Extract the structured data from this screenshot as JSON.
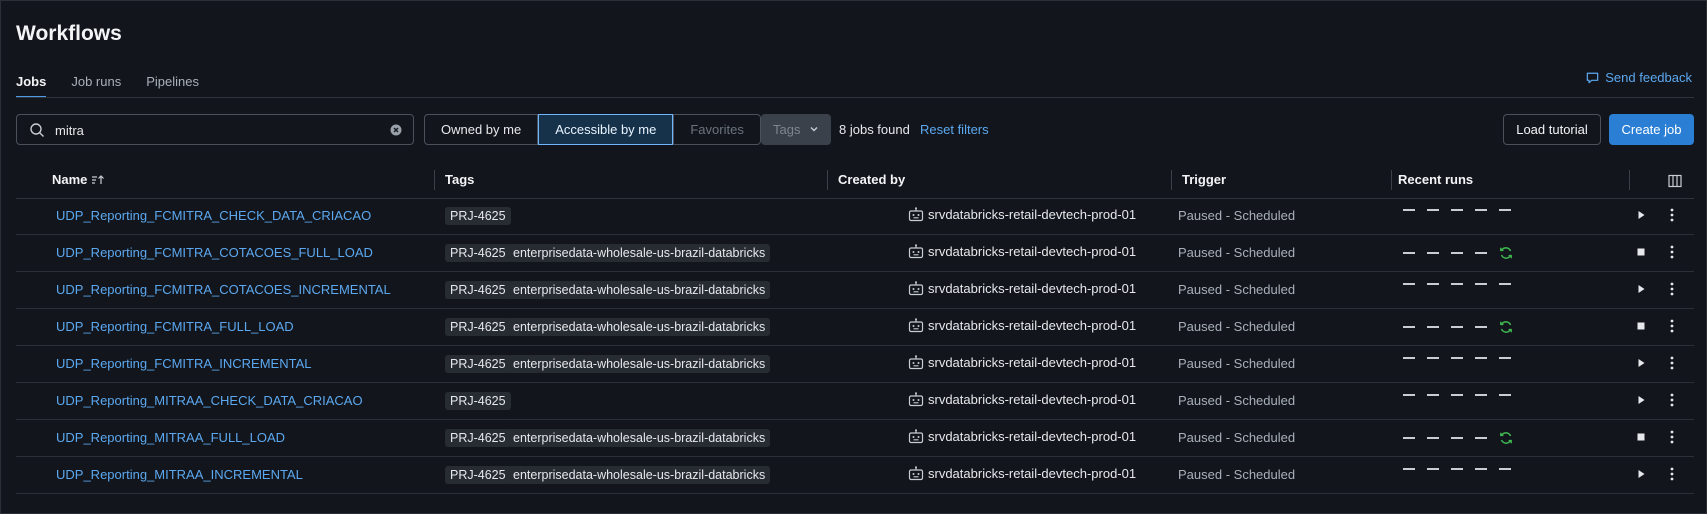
{
  "title": "Workflows",
  "tabs": [
    {
      "label": "Jobs",
      "active": true
    },
    {
      "label": "Job runs",
      "active": false
    },
    {
      "label": "Pipelines",
      "active": false
    }
  ],
  "feedback_label": "Send feedback",
  "search": {
    "value": "mitra",
    "placeholder": ""
  },
  "ownership_filter": {
    "owned": "Owned by me",
    "accessible": "Accessible by me",
    "favorites": "Favorites",
    "selected": "Accessible by me"
  },
  "tags_dropdown": "Tags",
  "jobs_found": "8 jobs found",
  "reset_filters": "Reset filters",
  "buttons": {
    "load_tutorial": "Load tutorial",
    "create_job": "Create job"
  },
  "columns": {
    "name": "Name",
    "tags": "Tags",
    "created_by": "Created by",
    "trigger": "Trigger",
    "recent_runs": "Recent runs"
  },
  "colors": {
    "accent": "#4e9ae6",
    "link": "#5ca8f0",
    "running": "#3fb950",
    "primary_button": "#2a7fd4"
  },
  "jobs": [
    {
      "name": "UDP_Reporting_FCMITRA_CHECK_DATA_CRIACAO",
      "tags": [
        "PRJ-4625"
      ],
      "created_by": "srvdatabricks-retail-devtech-prod-01",
      "trigger": "Paused - Scheduled",
      "running": false,
      "action_icon": "play-icon"
    },
    {
      "name": "UDP_Reporting_FCMITRA_COTACOES_FULL_LOAD",
      "tags": [
        "PRJ-4625",
        "enterprisedata-wholesale-us-brazil-databricks"
      ],
      "created_by": "srvdatabricks-retail-devtech-prod-01",
      "trigger": "Paused - Scheduled",
      "running": true,
      "action_icon": "stop-icon"
    },
    {
      "name": "UDP_Reporting_FCMITRA_COTACOES_INCREMENTAL",
      "tags": [
        "PRJ-4625",
        "enterprisedata-wholesale-us-brazil-databricks"
      ],
      "created_by": "srvdatabricks-retail-devtech-prod-01",
      "trigger": "Paused - Scheduled",
      "running": false,
      "action_icon": "play-icon"
    },
    {
      "name": "UDP_Reporting_FCMITRA_FULL_LOAD",
      "tags": [
        "PRJ-4625",
        "enterprisedata-wholesale-us-brazil-databricks"
      ],
      "created_by": "srvdatabricks-retail-devtech-prod-01",
      "trigger": "Paused - Scheduled",
      "running": true,
      "action_icon": "stop-icon"
    },
    {
      "name": "UDP_Reporting_FCMITRA_INCREMENTAL",
      "tags": [
        "PRJ-4625",
        "enterprisedata-wholesale-us-brazil-databricks"
      ],
      "created_by": "srvdatabricks-retail-devtech-prod-01",
      "trigger": "Paused - Scheduled",
      "running": false,
      "action_icon": "play-icon"
    },
    {
      "name": "UDP_Reporting_MITRAA_CHECK_DATA_CRIACAO",
      "tags": [
        "PRJ-4625"
      ],
      "created_by": "srvdatabricks-retail-devtech-prod-01",
      "trigger": "Paused - Scheduled",
      "running": false,
      "action_icon": "play-icon"
    },
    {
      "name": "UDP_Reporting_MITRAA_FULL_LOAD",
      "tags": [
        "PRJ-4625",
        "enterprisedata-wholesale-us-brazil-databricks"
      ],
      "created_by": "srvdatabricks-retail-devtech-prod-01",
      "trigger": "Paused - Scheduled",
      "running": true,
      "action_icon": "stop-icon"
    },
    {
      "name": "UDP_Reporting_MITRAA_INCREMENTAL",
      "tags": [
        "PRJ-4625",
        "enterprisedata-wholesale-us-brazil-databricks"
      ],
      "created_by": "srvdatabricks-retail-devtech-prod-01",
      "trigger": "Paused - Scheduled",
      "running": false,
      "action_icon": "play-icon"
    }
  ]
}
